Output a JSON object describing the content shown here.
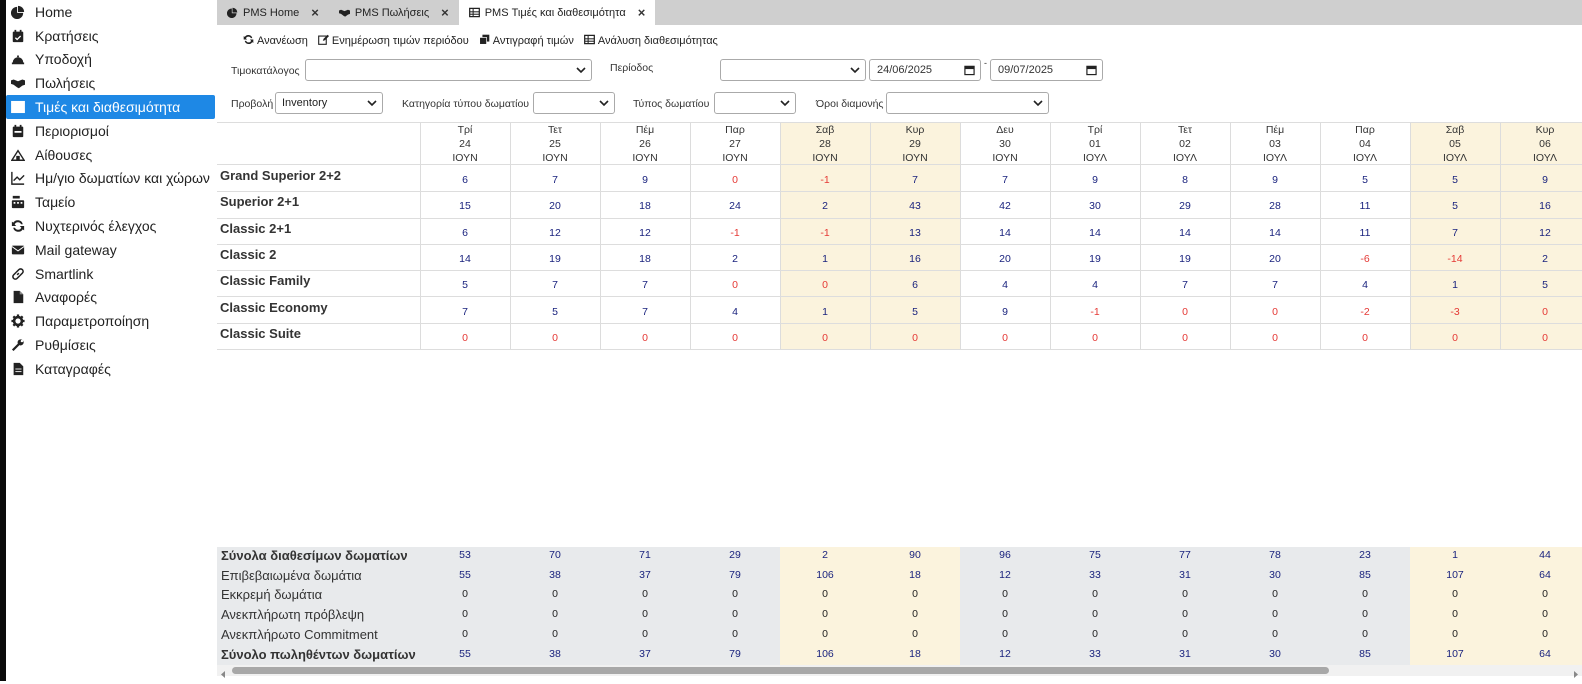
{
  "sidebar": {
    "items": [
      {
        "label": "Home",
        "icon": "pie-chart-icon"
      },
      {
        "label": "Κρατήσεις",
        "icon": "calendar-check-icon"
      },
      {
        "label": "Υποδοχή",
        "icon": "bell-icon"
      },
      {
        "label": "Πωλήσεις",
        "icon": "handshake-icon"
      },
      {
        "label": "Τιμές και διαθεσιμότητα",
        "icon": "table-icon",
        "active": true
      },
      {
        "label": "Περιορισμοί",
        "icon": "calendar-x-icon"
      },
      {
        "label": "Αίθουσες",
        "icon": "building-icon"
      },
      {
        "label": "Ημ/γιο δωματίων και χώρων",
        "icon": "chart-line-icon"
      },
      {
        "label": "Ταμείο",
        "icon": "cash-register-icon"
      },
      {
        "label": "Νυχτερινός έλεγχος",
        "icon": "refresh-icon"
      },
      {
        "label": "Mail gateway",
        "icon": "envelope-icon"
      },
      {
        "label": "Smartlink",
        "icon": "link-icon"
      },
      {
        "label": "Αναφορές",
        "icon": "file-icon"
      },
      {
        "label": "Παραμετροποίηση",
        "icon": "gear-icon"
      },
      {
        "label": "Ρυθμίσεις",
        "icon": "wrench-icon"
      },
      {
        "label": "Καταγραφές",
        "icon": "file-lines-icon"
      }
    ]
  },
  "tabs": [
    {
      "label": "PMS Home",
      "icon": "pie-chart-icon"
    },
    {
      "label": "PMS Πωλήσεις",
      "icon": "handshake-icon"
    },
    {
      "label": "PMS Τιμές και διαθεσιμότητα",
      "icon": "table-icon",
      "active": true
    }
  ],
  "toolbar": {
    "refresh": "Ανανέωση",
    "update_prices": "Ενημέρωση τιμών περιόδου",
    "copy_prices": "Αντιγραφή τιμών",
    "analysis": "Ανάλυση διαθεσιμότητας"
  },
  "filters": {
    "pricelist_label": "Τιμοκατάλογος",
    "pricelist_value": "",
    "period_label": "Περίοδος",
    "period_value": "",
    "date_from": "24/06/2025",
    "date_sep": "-",
    "date_to": "09/07/2025",
    "view_label": "Προβολή",
    "view_value": "Inventory",
    "room_category_label": "Κατηγορία τύπου δωματίου",
    "room_category_value": "",
    "room_type_label": "Τύπος δωματίου",
    "room_type_value": "",
    "stay_terms_label": "Όροι διαμονής",
    "stay_terms_value": ""
  },
  "days": [
    {
      "dow": "Τρί",
      "day": "24",
      "month": "ΙΟΥΝ",
      "weekend": false
    },
    {
      "dow": "Τετ",
      "day": "25",
      "month": "ΙΟΥΝ",
      "weekend": false
    },
    {
      "dow": "Πέμ",
      "day": "26",
      "month": "ΙΟΥΝ",
      "weekend": false
    },
    {
      "dow": "Παρ",
      "day": "27",
      "month": "ΙΟΥΝ",
      "weekend": false
    },
    {
      "dow": "Σαβ",
      "day": "28",
      "month": "ΙΟΥΝ",
      "weekend": true
    },
    {
      "dow": "Κυρ",
      "day": "29",
      "month": "ΙΟΥΝ",
      "weekend": true
    },
    {
      "dow": "Δευ",
      "day": "30",
      "month": "ΙΟΥΝ",
      "weekend": false
    },
    {
      "dow": "Τρί",
      "day": "01",
      "month": "ΙΟΥΛ",
      "weekend": false
    },
    {
      "dow": "Τετ",
      "day": "02",
      "month": "ΙΟΥΛ",
      "weekend": false
    },
    {
      "dow": "Πέμ",
      "day": "03",
      "month": "ΙΟΥΛ",
      "weekend": false
    },
    {
      "dow": "Παρ",
      "day": "04",
      "month": "ΙΟΥΛ",
      "weekend": false
    },
    {
      "dow": "Σαβ",
      "day": "05",
      "month": "ΙΟΥΛ",
      "weekend": true
    },
    {
      "dow": "Κυρ",
      "day": "06",
      "month": "ΙΟΥΛ",
      "weekend": true
    }
  ],
  "rooms": [
    {
      "name": "Grand Superior 2+2",
      "values": [
        "6",
        "7",
        "9",
        "0",
        "-1",
        "7",
        "7",
        "9",
        "8",
        "9",
        "5",
        "5",
        "9"
      ]
    },
    {
      "name": "Superior 2+1",
      "values": [
        "15",
        "20",
        "18",
        "24",
        "2",
        "43",
        "42",
        "30",
        "29",
        "28",
        "11",
        "5",
        "16"
      ]
    },
    {
      "name": "Classic 2+1",
      "values": [
        "6",
        "12",
        "12",
        "-1",
        "-1",
        "13",
        "14",
        "14",
        "14",
        "14",
        "11",
        "7",
        "12"
      ]
    },
    {
      "name": "Classic 2",
      "values": [
        "14",
        "19",
        "18",
        "2",
        "1",
        "16",
        "20",
        "19",
        "19",
        "20",
        "-6",
        "-14",
        "2"
      ]
    },
    {
      "name": "Classic Family",
      "values": [
        "5",
        "7",
        "7",
        "0",
        "0",
        "6",
        "4",
        "4",
        "7",
        "7",
        "4",
        "1",
        "5"
      ]
    },
    {
      "name": "Classic Economy",
      "values": [
        "7",
        "5",
        "7",
        "4",
        "1",
        "5",
        "9",
        "-1",
        "0",
        "0",
        "-2",
        "-3",
        "0"
      ]
    },
    {
      "name": "Classic Suite",
      "values": [
        "0",
        "0",
        "0",
        "0",
        "0",
        "0",
        "0",
        "0",
        "0",
        "0",
        "0",
        "0",
        "0"
      ]
    }
  ],
  "summary": [
    {
      "label": "Σύνολα διαθεσίμων δωματίων",
      "bold": true,
      "values": [
        "53",
        "70",
        "71",
        "29",
        "2",
        "90",
        "96",
        "75",
        "77",
        "78",
        "23",
        "1",
        "44"
      ]
    },
    {
      "label": "Επιβεβαιωμένα δωμάτια",
      "bold": false,
      "values": [
        "55",
        "38",
        "37",
        "79",
        "106",
        "18",
        "12",
        "33",
        "31",
        "30",
        "85",
        "107",
        "64"
      ]
    },
    {
      "label": "Εκκρεμή δωμάτια",
      "bold": false,
      "values": [
        "0",
        "0",
        "0",
        "0",
        "0",
        "0",
        "0",
        "0",
        "0",
        "0",
        "0",
        "0",
        "0"
      ]
    },
    {
      "label": "Ανεκπλήρωτη πρόβλεψη",
      "bold": false,
      "values": [
        "0",
        "0",
        "0",
        "0",
        "0",
        "0",
        "0",
        "0",
        "0",
        "0",
        "0",
        "0",
        "0"
      ]
    },
    {
      "label": "Ανεκπλήρωτο Commitment",
      "bold": false,
      "values": [
        "0",
        "0",
        "0",
        "0",
        "0",
        "0",
        "0",
        "0",
        "0",
        "0",
        "0",
        "0",
        "0"
      ]
    },
    {
      "label": "Σύνολο πωληθέντων δωματίων",
      "bold": true,
      "values": [
        "55",
        "38",
        "37",
        "79",
        "106",
        "18",
        "12",
        "33",
        "31",
        "30",
        "85",
        "107",
        "64"
      ]
    }
  ]
}
